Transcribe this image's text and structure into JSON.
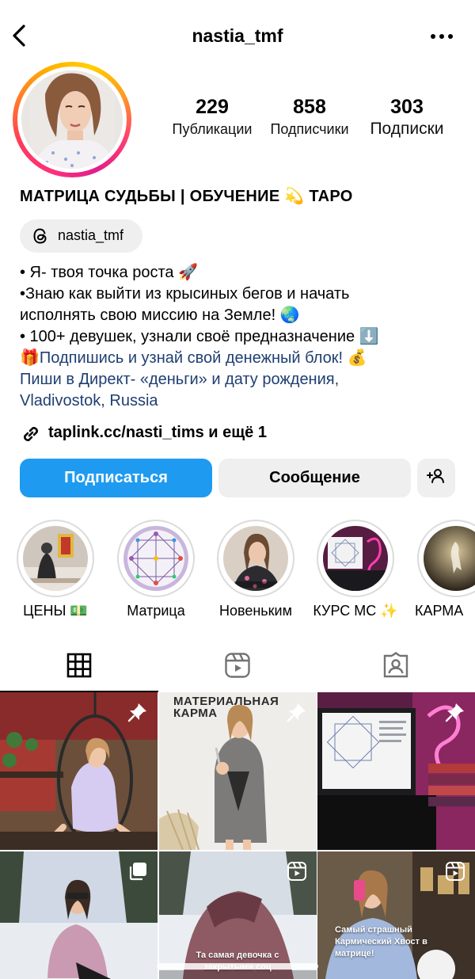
{
  "header": {
    "username": "nastia_tmf"
  },
  "stats": [
    {
      "value": "229",
      "label": "Публикации"
    },
    {
      "value": "858",
      "label": "Подписчики"
    },
    {
      "value": "303",
      "label": "Подписки"
    }
  ],
  "bio": {
    "title": "МАТРИЦА СУДЬБЫ | ОБУЧЕНИЕ 💫 ТАРО",
    "threads_handle": "nastia_tmf",
    "line1": "• Я- твоя точка роста 🚀",
    "line2": "•Знаю как выйти из крысиных бегов и начать",
    "line3": "исполнять свою миссию на Земле! 🌏",
    "line4": "• 100+ девушек, узнали своё предназначение ⬇️",
    "line5": "🎁Подпишись и узнай свой денежный блок! 💰",
    "line6": "Пиши в Директ- «деньги» и дату рождения,",
    "location": "Vladivostok, Russia",
    "link_text": "taplink.cc/nasti_tims и ещё 1"
  },
  "buttons": {
    "follow": "Подписаться",
    "message": "Сообщение"
  },
  "highlights": [
    {
      "label": "ЦЕНЫ 💵"
    },
    {
      "label": "Матрица"
    },
    {
      "label": "Новеньким"
    },
    {
      "label": "КУРС МС ✨"
    },
    {
      "label": "КАРМА"
    }
  ],
  "posts": {
    "p2_overlay": "МАТЕРИАЛЬНАЯ КАРМА",
    "p5_caption": "Та самая девочка с закрытыми соц",
    "p6_caption": "Самый страшный Кармический Хвост в матрице!"
  },
  "colors": {
    "follow_button": "#1e9bf0",
    "link": "#1f3f71",
    "chip_bg": "#efefef"
  }
}
